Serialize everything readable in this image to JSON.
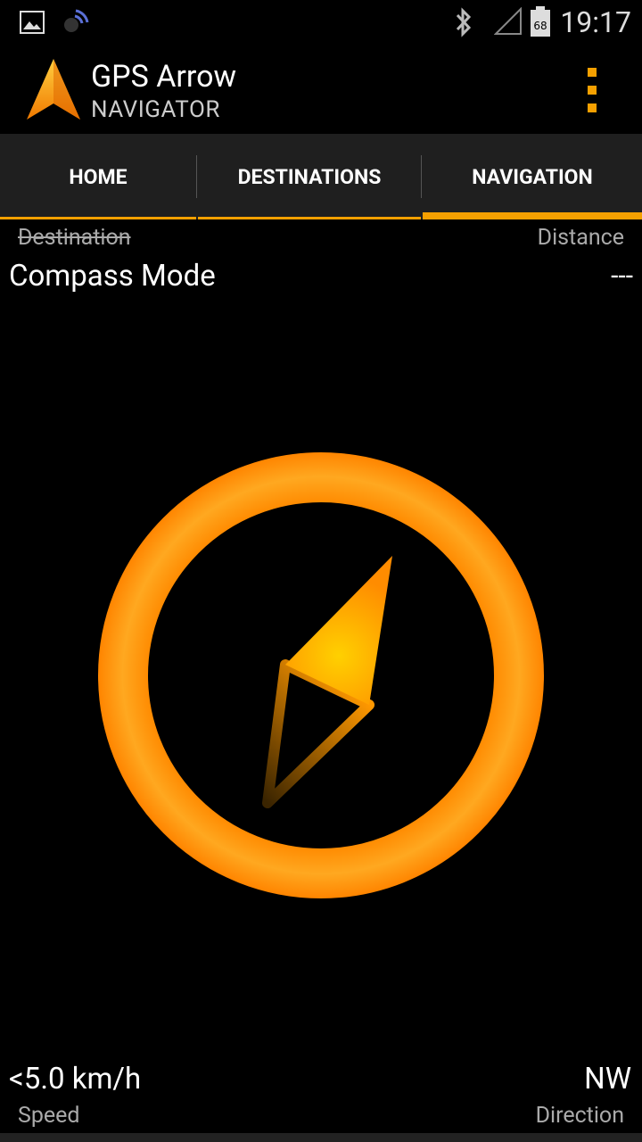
{
  "status_bar": {
    "time": "19:17",
    "battery_level": "68",
    "icons": [
      "image-icon",
      "signal-wave-icon",
      "bluetooth-icon",
      "cell-signal-icon",
      "battery-icon"
    ]
  },
  "app_bar": {
    "title": "GPS Arrow",
    "subtitle": "NAVIGATOR",
    "logo_icon": "orange-arrow-icon",
    "menu_icon": "overflow-menu-icon"
  },
  "tabs": [
    {
      "label": "HOME",
      "active": false
    },
    {
      "label": "DESTINATIONS",
      "active": false
    },
    {
      "label": "NAVIGATION",
      "active": true
    }
  ],
  "navigation": {
    "destination_label": "Destination",
    "distance_label": "Distance",
    "mode_value": "Compass Mode",
    "distance_value": "---",
    "speed_value": "<5.0 km/h",
    "speed_label": "Speed",
    "direction_value": "NW",
    "direction_label": "Direction"
  },
  "colors": {
    "accent": "#f5a000",
    "background": "#000000",
    "tab_background": "#1f1f1f"
  }
}
